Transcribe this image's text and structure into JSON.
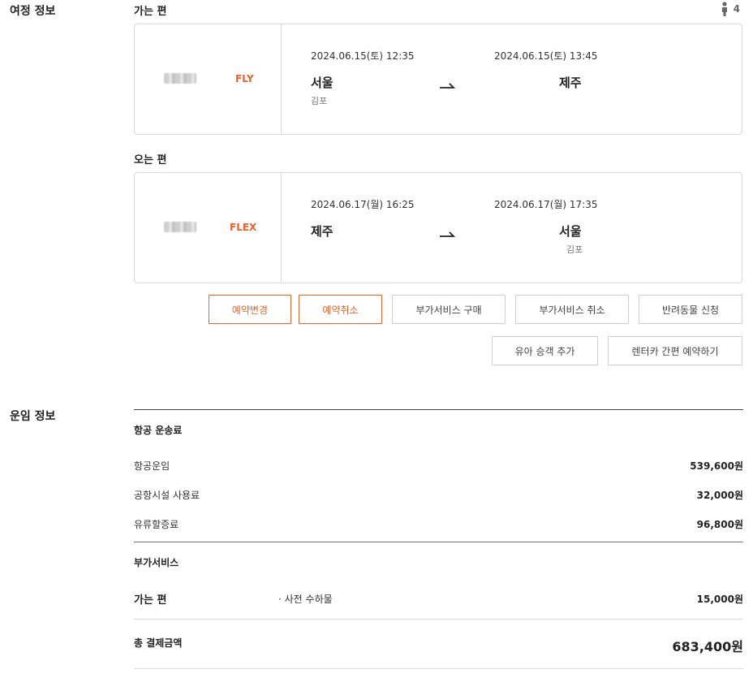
{
  "itinerary": {
    "section_title": "여정 정보",
    "passenger_count": "4",
    "outbound": {
      "label": "가는 편",
      "fare_type": "FLY",
      "depart_datetime": "2024.06.15(토) 12:35",
      "arrive_datetime": "2024.06.15(토) 13:45",
      "depart_city": "서울",
      "depart_airport": "김포",
      "arrive_city": "제주",
      "arrive_airport": ""
    },
    "inbound": {
      "label": "오는 편",
      "fare_type": "FLEX",
      "depart_datetime": "2024.06.17(월) 16:25",
      "arrive_datetime": "2024.06.17(월) 17:35",
      "depart_city": "제주",
      "depart_airport": "",
      "arrive_city": "서울",
      "arrive_airport": "김포"
    },
    "buttons": {
      "change": "예약변경",
      "cancel": "예약취소",
      "buy_service": "부가서비스 구매",
      "cancel_service": "부가서비스 취소",
      "pet": "반려동물 신청",
      "add_infant": "유아 승객 추가",
      "rent_car": "렌터카 간편 예약하기"
    }
  },
  "fare": {
    "section_title": "운임 정보",
    "air_transport_title": "항공 운송료",
    "rows": [
      {
        "label": "항공운임",
        "value": "539,600원"
      },
      {
        "label": "공항시설 사용료",
        "value": "32,000원"
      },
      {
        "label": "유류할증료",
        "value": "96,800원"
      }
    ],
    "extra_title": "부가서비스",
    "extra_leg": "가는 편",
    "extra_item": "· 사전 수하물",
    "extra_value": "15,000원",
    "total_label": "총 결제금액",
    "total_value": "683,400원"
  },
  "colors": {
    "accent": "#e8622b",
    "border": "#d9d9d9",
    "text": "#222222"
  }
}
